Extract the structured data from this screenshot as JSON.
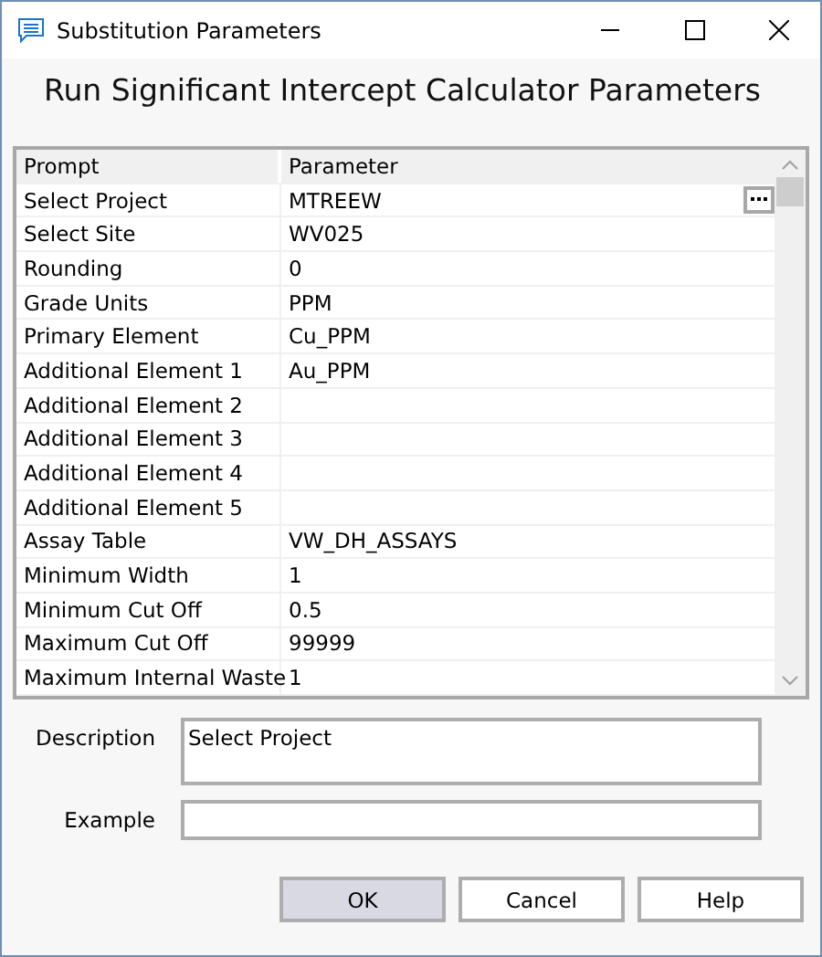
{
  "window": {
    "title": "Substitution Parameters"
  },
  "heading": "Run Significant Intercept Calculator Parameters",
  "table": {
    "columns": [
      "Prompt",
      "Parameter"
    ],
    "rows": [
      {
        "prompt": "Select Project",
        "parameter": "MTREEW",
        "browse": true
      },
      {
        "prompt": "Select Site",
        "parameter": "WV025",
        "browse": false
      },
      {
        "prompt": "Rounding",
        "parameter": "0",
        "browse": false
      },
      {
        "prompt": "Grade Units",
        "parameter": "PPM",
        "browse": false
      },
      {
        "prompt": "Primary Element",
        "parameter": "Cu_PPM",
        "browse": false
      },
      {
        "prompt": "Additional Element 1",
        "parameter": "Au_PPM",
        "browse": false
      },
      {
        "prompt": "Additional Element 2",
        "browse": false
      },
      {
        "prompt": "Additional Element 3",
        "browse": false
      },
      {
        "prompt": "Additional Element 4",
        "browse": false
      },
      {
        "prompt": "Additional Element 5",
        "browse": false
      },
      {
        "prompt": "Assay Table",
        "parameter": "VW_DH_ASSAYS",
        "browse": false
      },
      {
        "prompt": "Minimum Width",
        "parameter": "1",
        "browse": false
      },
      {
        "prompt": "Minimum Cut Off",
        "parameter": "0.5",
        "browse": false
      },
      {
        "prompt": "Maximum Cut Off",
        "parameter": "99999",
        "browse": false
      },
      {
        "prompt": "Maximum Internal Waste",
        "parameter": "1",
        "browse": false
      }
    ]
  },
  "description": {
    "label": "Description",
    "value": "Select Project"
  },
  "example": {
    "label": "Example"
  },
  "buttons": [
    {
      "label": "OK",
      "default": true
    },
    {
      "label": "Cancel",
      "default": false
    },
    {
      "label": "Help",
      "default": false
    }
  ]
}
